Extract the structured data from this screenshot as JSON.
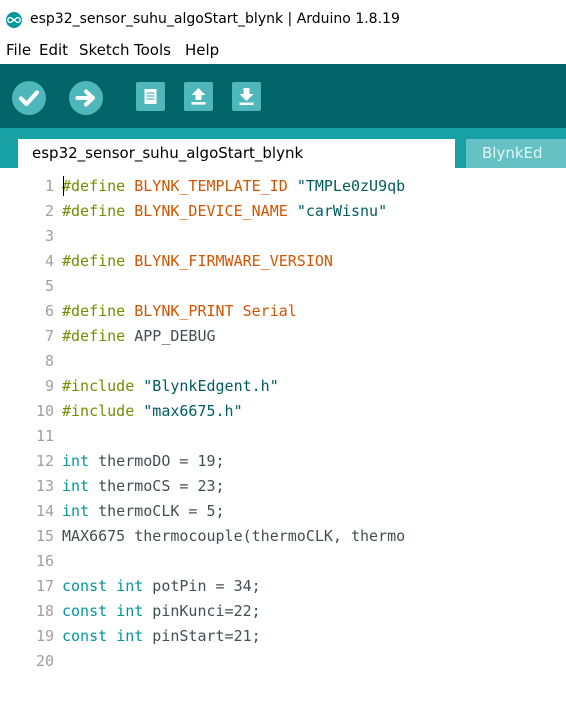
{
  "window": {
    "title": "esp32_sensor_suhu_algoStart_blynk | Arduino 1.8.19"
  },
  "menu": [
    "File",
    "Edit",
    "Sketch",
    "Tools",
    "Help"
  ],
  "toolbar": {
    "buttons": [
      "verify-icon",
      "upload-icon",
      "new-icon",
      "open-icon",
      "save-icon"
    ],
    "colors": {
      "bar": "#006468",
      "button": "#4db7bb"
    }
  },
  "tabs": [
    {
      "label": "esp32_sensor_suhu_algoStart_blynk",
      "active": true
    },
    {
      "label": "BlynkEd",
      "active": false
    }
  ],
  "editor": {
    "lines": [
      {
        "n": "1",
        "tokens": [
          [
            "kw",
            "#define"
          ],
          [
            "pl",
            " "
          ],
          [
            "id",
            "BLYNK_TEMPLATE_ID"
          ],
          [
            "pl",
            " "
          ],
          [
            "st",
            "\"TMPLe0zU9qb"
          ]
        ]
      },
      {
        "n": "2",
        "tokens": [
          [
            "kw",
            "#define"
          ],
          [
            "pl",
            " "
          ],
          [
            "id",
            "BLYNK_DEVICE_NAME"
          ],
          [
            "pl",
            " "
          ],
          [
            "st",
            "\"carWisnu\""
          ]
        ]
      },
      {
        "n": "3",
        "tokens": []
      },
      {
        "n": "4",
        "tokens": [
          [
            "kw",
            "#define"
          ],
          [
            "pl",
            " "
          ],
          [
            "id",
            "BLYNK_FIRMWARE_VERSION"
          ]
        ]
      },
      {
        "n": "5",
        "tokens": []
      },
      {
        "n": "6",
        "tokens": [
          [
            "kw",
            "#define"
          ],
          [
            "pl",
            " "
          ],
          [
            "id",
            "BLYNK_PRINT"
          ],
          [
            "pl",
            " "
          ],
          [
            "id",
            "Serial"
          ]
        ]
      },
      {
        "n": "7",
        "tokens": [
          [
            "kw",
            "#define"
          ],
          [
            "pl",
            " APP_DEBUG"
          ]
        ]
      },
      {
        "n": "8",
        "tokens": []
      },
      {
        "n": "9",
        "tokens": [
          [
            "kw",
            "#include"
          ],
          [
            "pl",
            " "
          ],
          [
            "st",
            "\"BlynkEdgent.h\""
          ]
        ]
      },
      {
        "n": "10",
        "tokens": [
          [
            "kw",
            "#include"
          ],
          [
            "pl",
            " "
          ],
          [
            "st",
            "\"max6675.h\""
          ]
        ]
      },
      {
        "n": "11",
        "tokens": []
      },
      {
        "n": "12",
        "tokens": [
          [
            "ty",
            "int"
          ],
          [
            "pl",
            " thermoDO = 19;"
          ]
        ]
      },
      {
        "n": "13",
        "tokens": [
          [
            "ty",
            "int"
          ],
          [
            "pl",
            " thermoCS = 23;"
          ]
        ]
      },
      {
        "n": "14",
        "tokens": [
          [
            "ty",
            "int"
          ],
          [
            "pl",
            " thermoCLK = 5;"
          ]
        ]
      },
      {
        "n": "15",
        "tokens": [
          [
            "pl",
            "MAX6675 thermocouple(thermoCLK, thermo"
          ]
        ]
      },
      {
        "n": "16",
        "tokens": []
      },
      {
        "n": "17",
        "tokens": [
          [
            "ty",
            "const"
          ],
          [
            "pl",
            " "
          ],
          [
            "ty",
            "int"
          ],
          [
            "pl",
            " potPin = 34;"
          ]
        ]
      },
      {
        "n": "18",
        "tokens": [
          [
            "ty",
            "const"
          ],
          [
            "pl",
            " "
          ],
          [
            "ty",
            "int"
          ],
          [
            "pl",
            " pinKunci=22;"
          ]
        ]
      },
      {
        "n": "19",
        "tokens": [
          [
            "ty",
            "const"
          ],
          [
            "pl",
            " "
          ],
          [
            "ty",
            "int"
          ],
          [
            "pl",
            " pinStart=21;"
          ]
        ]
      },
      {
        "n": "20",
        "tokens": []
      }
    ]
  }
}
